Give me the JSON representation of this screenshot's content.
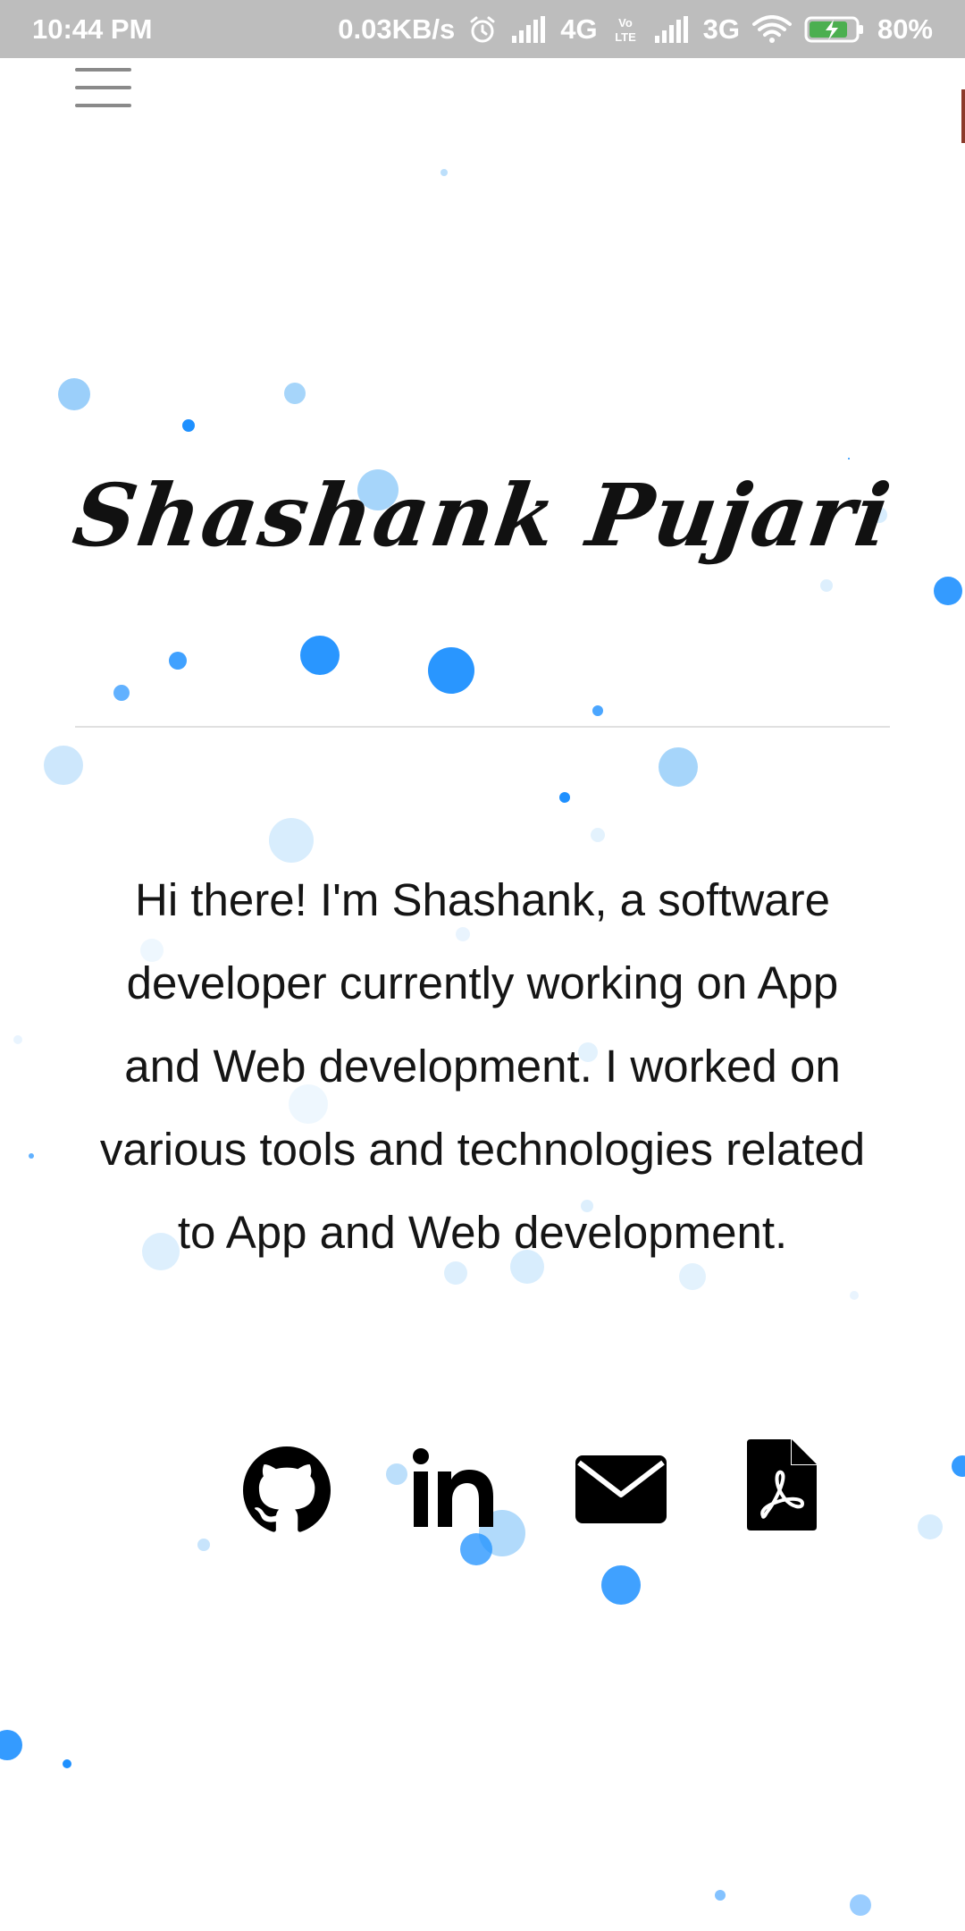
{
  "status_bar": {
    "time": "10:44 PM",
    "speed": "0.03KB/s",
    "network_1": "4G",
    "volte": "VoLTE",
    "network_2": "3G",
    "battery": "80%"
  },
  "header": {
    "menu_icon": "hamburger-menu-icon"
  },
  "hero": {
    "name": "Shashank Pujari",
    "bio": "Hi there! I'm Shashank, a software developer currently working on App and Web development. I worked on various tools and technologies related to App and Web development."
  },
  "social_links": [
    {
      "name": "GitHub",
      "icon": "github-icon"
    },
    {
      "name": "LinkedIn",
      "icon": "linkedin-icon"
    },
    {
      "name": "Email",
      "icon": "email-icon"
    },
    {
      "name": "Resume PDF",
      "icon": "pdf-icon"
    }
  ],
  "colors": {
    "particle": "#1e90ff",
    "particle_light": "#90caf9",
    "status_bar_bg": "#bdbdbd",
    "text": "#151515"
  }
}
